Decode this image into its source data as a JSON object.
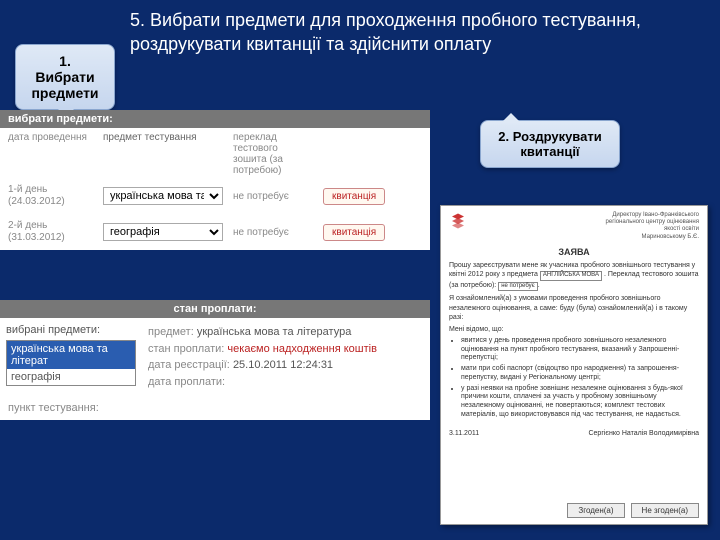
{
  "title": "5. Вибрати предмети для проходження пробного тестування, роздрукувати квитанції та здійснити оплату",
  "callouts": {
    "c1": "1. Вибрати предмети",
    "c2": "2. Роздрукувати квитанції"
  },
  "panel_top": {
    "bar": "вибрати предмети:",
    "hdr_date": "дата проведення",
    "hdr_subj": "предмет тестування",
    "hdr_trans": "переклад тестового зошита (за потребою)",
    "rows": [
      {
        "date": "1-й день\n(24.03.2012)",
        "subject": "українська мова та",
        "trans": "не потребує",
        "receipt": "квитанція"
      },
      {
        "date": "2-й день\n(31.03.2012)",
        "subject": "географія",
        "trans": "не потребує",
        "receipt": "квитанція"
      }
    ]
  },
  "panel_bottom": {
    "bar": "стан проплати:",
    "chosen_label": "вибрані предмети:",
    "chosen": [
      "українська мова та літерат",
      "географія"
    ],
    "subject_label": "предмет:",
    "subject_value": "українська мова та література",
    "status_label": "стан проплати:",
    "status_value": "чекаємо надходження коштів",
    "reg_label": "дата реєстрації:",
    "reg_value": "25.10.2011 12:24:31",
    "pay_label": "дата проплати:",
    "punkt": "пункт тестування:"
  },
  "doc": {
    "addr1": "Директору Івано-Франківського",
    "addr2": "регіонального центру оцінювання",
    "addr3": "якості освіти",
    "addr4": "Мариновському Б.Є.",
    "heading": "ЗАЯВА",
    "p1a": "Прошу зареєструвати мене як учасника пробного зовнішнього тестування у квітні 2012 року з предмета ",
    "subj_slot": "АНГЛІЙСЬКА МОВА",
    "p1b": ". Переклад тестового зошита (за потребою): ",
    "trans_slot": "не потребує",
    "p2": "Я ознайомлений(а) з умовами проведення пробного зовнішнього незалежного оцінювання, а саме: буду (була) ознайомлений(а) і в такому разі:",
    "li_label": "Мені відомо, що:",
    "li1": "явитися у день проведення пробного зовнішнього незалежного оцінювання на пункт пробного тестування, вказаний у Запрошенні-перепустці;",
    "li2": "мати при собі паспорт (свідоцтво про народження) та запрошення-перепустку, видані у Регіональному центрі;",
    "li3": "у разі неявки на пробне зовнішнє незалежне оцінювання з будь-якої причини кошти, сплачені за участь у пробному зовнішньому незалежному оцінюванні, не повертаються; комплект тестових матеріалів, що використовувався під час тестування, не надається.",
    "date": "3.11.2011",
    "sign": "Сергієнко Наталія Володимирівна",
    "btn_agree": "Згоден(а)",
    "btn_disagree": "Не згоден(а)"
  }
}
